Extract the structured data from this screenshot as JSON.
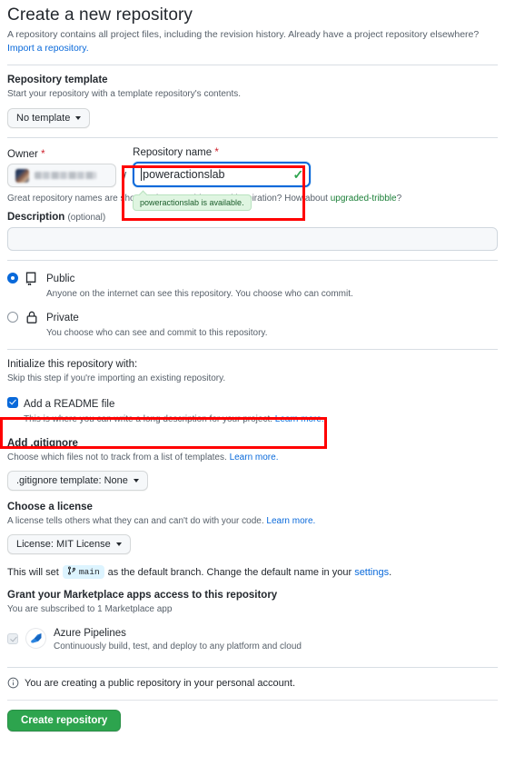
{
  "header": {
    "title": "Create a new repository",
    "description": "A repository contains all project files, including the revision history. Already have a project repository elsewhere?",
    "import_link": "Import a repository."
  },
  "template_section": {
    "label": "Repository template",
    "hint": "Start your repository with a template repository's contents.",
    "selected": "No template"
  },
  "name_section": {
    "owner_label": "Owner",
    "owner_required": "*",
    "owner_value": "",
    "separator": "/",
    "name_label": "Repository name",
    "name_required": "*",
    "name_value": "poweractionslab",
    "availability_tooltip": "poweractionslab is available.",
    "valid_icon": "✓",
    "hint_prefix": "Great repository names are short and memorable. Need inspiration? How about ",
    "hint_suggestion": "upgraded-tribble",
    "hint_suffix": "?"
  },
  "description_section": {
    "label": "Description",
    "optional": "(optional)",
    "value": "",
    "placeholder": ""
  },
  "visibility": {
    "options": [
      {
        "id": "public",
        "title": "Public",
        "subtitle": "Anyone on the internet can see this repository. You choose who can commit.",
        "selected": true,
        "icon": "repo-icon"
      },
      {
        "id": "private",
        "title": "Private",
        "subtitle": "You choose who can see and commit to this repository.",
        "selected": false,
        "icon": "lock-icon"
      }
    ]
  },
  "initialize": {
    "label": "Initialize this repository with:",
    "hint": "Skip this step if you're importing an existing repository.",
    "readme": {
      "title": "Add a README file",
      "subtitle": "This is where you can write a long description for your project.",
      "learn_more": "Learn more.",
      "checked": true
    },
    "gitignore": {
      "label": "Add .gitignore",
      "hint": "Choose which files not to track from a list of templates.",
      "learn_more": "Learn more.",
      "selected": ".gitignore template: None"
    },
    "license": {
      "label": "Choose a license",
      "hint": "A license tells others what they can and can't do with your code.",
      "learn_more": "Learn more.",
      "selected": "License: MIT License"
    }
  },
  "branch_notice": {
    "prefix": "This will set",
    "branch_name": "main",
    "middle": "as the default branch. Change the default name in your",
    "settings_link": "settings",
    "suffix": "."
  },
  "marketplace": {
    "label": "Grant your Marketplace apps access to this repository",
    "hint": "You are subscribed to 1 Marketplace app",
    "apps": [
      {
        "name": "Azure Pipelines",
        "description": "Continuously build, test, and deploy to any platform and cloud",
        "icon": "azure-pipelines-icon",
        "checked": true,
        "disabled": true
      }
    ]
  },
  "footer": {
    "notice": "You are creating a public repository in your personal account.",
    "notice_icon": "info-icon",
    "submit_label": "Create repository"
  },
  "colors": {
    "accent": "#0969da",
    "success": "#2da44e",
    "danger": "#cf222e",
    "highlight": "#ff0000",
    "tooltip_bg": "#dff5e1",
    "muted": "#57606a"
  }
}
